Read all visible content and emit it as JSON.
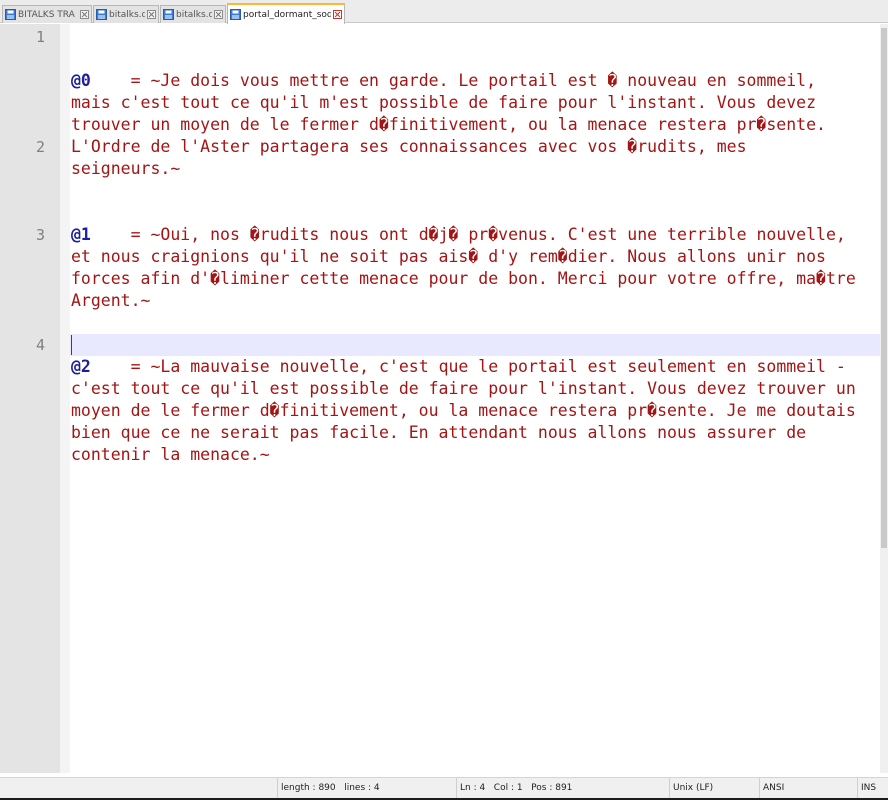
{
  "tabs": [
    {
      "label": "BITALKS TRA",
      "active": false
    },
    {
      "label": "bitalks.d",
      "active": false
    },
    {
      "label": "bitalks.d",
      "active": false
    },
    {
      "label": "portal_dormant_sod.tra",
      "active": true
    }
  ],
  "editor": {
    "line_numbers": [
      "1",
      "2",
      "3",
      "4"
    ],
    "entries": [
      {
        "key": "@0",
        "separator": "    = ",
        "text": "~Je dois vous mettre en garde. Le portail est � nouveau en sommeil, mais c'est tout ce qu'il m'est possible de faire pour l'instant. Vous devez trouver un moyen de le fermer d�finitivement, ou la menace restera pr�sente. L'Ordre de l'Aster partagera ses connaissances avec vos �rudits, mes seigneurs.~"
      },
      {
        "key": "@1",
        "separator": "    = ",
        "text": "~Oui, nos �rudits nous ont d�j� pr�venus. C'est une terrible nouvelle, et nous craignions qu'il ne soit pas ais� d'y rem�dier. Nous allons unir nos forces afin d'�liminer cette menace pour de bon. Merci pour votre offre, ma�tre Argent.~"
      },
      {
        "key": "@2",
        "separator": "    = ",
        "text": "~La mauvaise nouvelle, c'est que le portail est seulement en sommeil - c'est tout ce qu'il est possible de faire pour l'instant. Vous devez trouver un moyen de le fermer d�finitivement, ou la menace restera pr�sente. Je me doutais bien que ce ne serait pas facile. En attendant nous allons nous assurer de contenir la menace.~"
      }
    ],
    "key_color": "#1e1e9c",
    "text_color": "#a31515",
    "current_line_color": "#e8e8ff"
  },
  "statusbar": {
    "length": "length : 890",
    "lines": "lines : 4",
    "ln": "Ln : 4",
    "col": "Col : 1",
    "pos": "Pos : 891",
    "eol": "Unix (LF)",
    "encoding": "ANSI",
    "mode": "INS"
  }
}
